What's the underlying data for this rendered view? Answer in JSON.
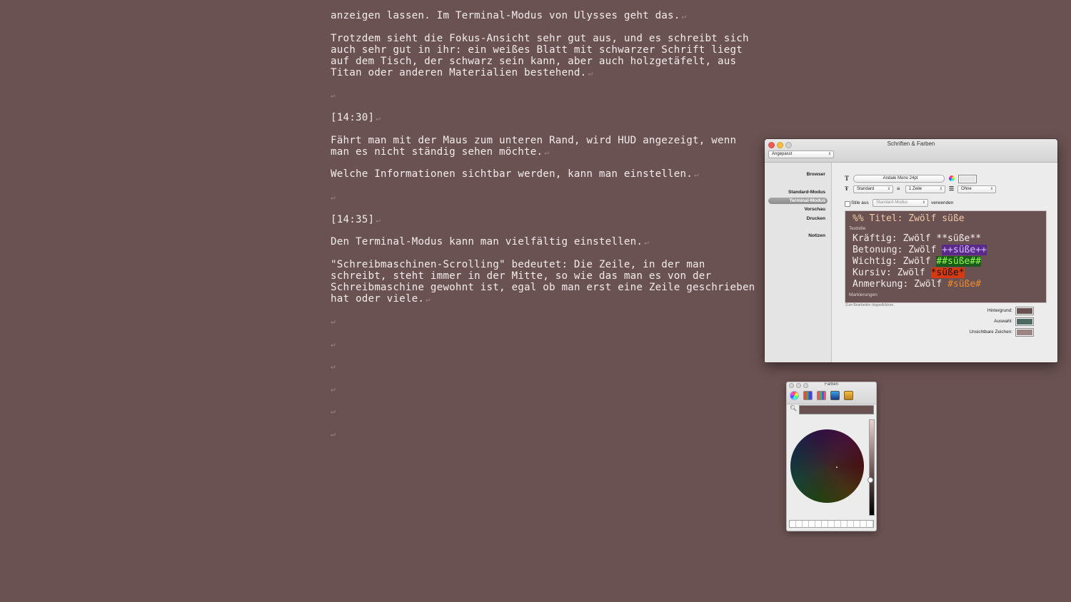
{
  "editor": {
    "lines": [
      "anzeigen lassen. Im Terminal-Modus von Ulysses geht das.",
      "Trotzdem sieht die Fokus-Ansicht sehr gut aus, und es schreibt sich",
      "auch sehr gut in ihr: ein weißes Blatt mit schwarzer Schrift liegt",
      "auf dem Tisch, der schwarz sein kann, aber auch holzgetäfelt, aus",
      "Titan oder anderen Materialien bestehend.",
      "[14:30]",
      "Fährt man mit der Maus zum unteren Rand, wird HUD angezeigt, wenn",
      "man es nicht ständig sehen möchte.",
      "Welche Informationen sichtbar werden, kann man einstellen.",
      "[14:35]",
      "Den Terminal-Modus kann man vielfältig einstellen.",
      "\"Schreibmaschinen-Scrolling\" bedeutet: Die Zeile, in der man",
      "schreibt, steht immer in der Mitte, so wie das man es von der",
      "Schreibmaschine gewohnt ist, egal ob man erst eine Zeile geschrieben",
      "hat oder viele."
    ],
    "return_mark": "↵"
  },
  "prefs": {
    "title": "Schriften & Farben",
    "theme_popup": "Angepasst",
    "sidebar": [
      "Browser",
      "Standard-Modus",
      "Terminal-Modus",
      "Vorschau",
      "Drucken",
      "Notizen"
    ],
    "font_button": "Andale Mono 24pt",
    "style_popup": "Standard",
    "line_popup": "1 Zeile",
    "indent_popup": "Ohne",
    "styles_from_label": "Stile aus",
    "styles_from_popup": "Standard-Modus",
    "use_label": "verwenden",
    "preview": {
      "title_line": "%% Titel: Zwölf süße",
      "section_textstile": "Textstile",
      "kraeftig_prefix": "Kräftig: Zwölf ",
      "kraeftig_mark": "**süße**",
      "betonung_prefix": "Betonung: Zwölf ",
      "betonung_mark": "++süße++",
      "wichtig_prefix": "Wichtig: Zwölf ",
      "wichtig_mark": "##süße##",
      "kursiv_prefix": "Kursiv: Zwölf ",
      "kursiv_mark": "*süße*",
      "anmerkung_prefix": "Anmerkung: Zwölf ",
      "anmerkung_mark": "#süße#",
      "section_markierungen": "Markierungen"
    },
    "hint": "Zum Bearbeiten doppelklicken.",
    "hintergrund_label": "Hintergrund:",
    "auswahl_label": "Auswahl:",
    "unsichtbar_label": "Unsichtbare Zeichen:",
    "colors": {
      "background": "#6b5252",
      "selection": "#4d6b62",
      "invisible": "#9c8585"
    }
  },
  "colorpanel": {
    "title": "Farben",
    "current_color": "#6b5252"
  }
}
